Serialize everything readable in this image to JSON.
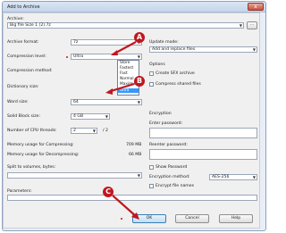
{
  "window": {
    "title": "Add to Archive",
    "close_glyph": "x"
  },
  "archive": {
    "label": "Archive:",
    "value": "Big file Size 1 (2).7z",
    "browse_label": "..."
  },
  "left": {
    "format": {
      "label": "Archive format:",
      "value": "7z"
    },
    "level": {
      "label": "Compression level:",
      "value": "Ultra"
    },
    "method": {
      "label": "Compression method:"
    },
    "dictionary": {
      "label": "Dictionary size:"
    },
    "word": {
      "label": "Word size:",
      "value": "64"
    },
    "solid": {
      "label": "Solid Block size:",
      "value": "4 GB"
    },
    "threads": {
      "label": "Number of CPU threads:",
      "value": "2",
      "max": "/ 2"
    },
    "mem_compress": {
      "label": "Memory usage for Compressing:",
      "value": "709 MB"
    },
    "mem_decompress": {
      "label": "Memory usage for Decompressing:",
      "value": "66 MB"
    },
    "split": {
      "label": "Split to volumes, bytes:"
    },
    "parameters": {
      "label": "Parameters:"
    }
  },
  "dropdown": {
    "options": [
      "Store",
      "Fastest",
      "Fast",
      "Normal",
      "Maximum",
      "Ultra"
    ],
    "highlighted": "Ultra"
  },
  "right": {
    "update_mode": {
      "label": "Update mode:",
      "value": "Add and replace files"
    },
    "options": {
      "heading": "Options",
      "sfx_label": "Create SFX archive",
      "compress_shared_label": "Compress shared files"
    },
    "encryption": {
      "heading": "Encryption",
      "enter_password_label": "Enter password:",
      "reenter_password_label": "Reenter password:",
      "show_password_label": "Show Password",
      "method_label": "Encryption method:",
      "method_value": "AES-256",
      "encrypt_names_label": "Encrypt file names"
    }
  },
  "buttons": {
    "ok": "OK",
    "cancel": "Cancel",
    "help": "Help"
  },
  "callouts": {
    "a": "A",
    "b": "B",
    "c": "C"
  },
  "colors": {
    "callout": "#c0171f",
    "highlight": "#3399ff",
    "window_border": "#8fa2bd"
  }
}
